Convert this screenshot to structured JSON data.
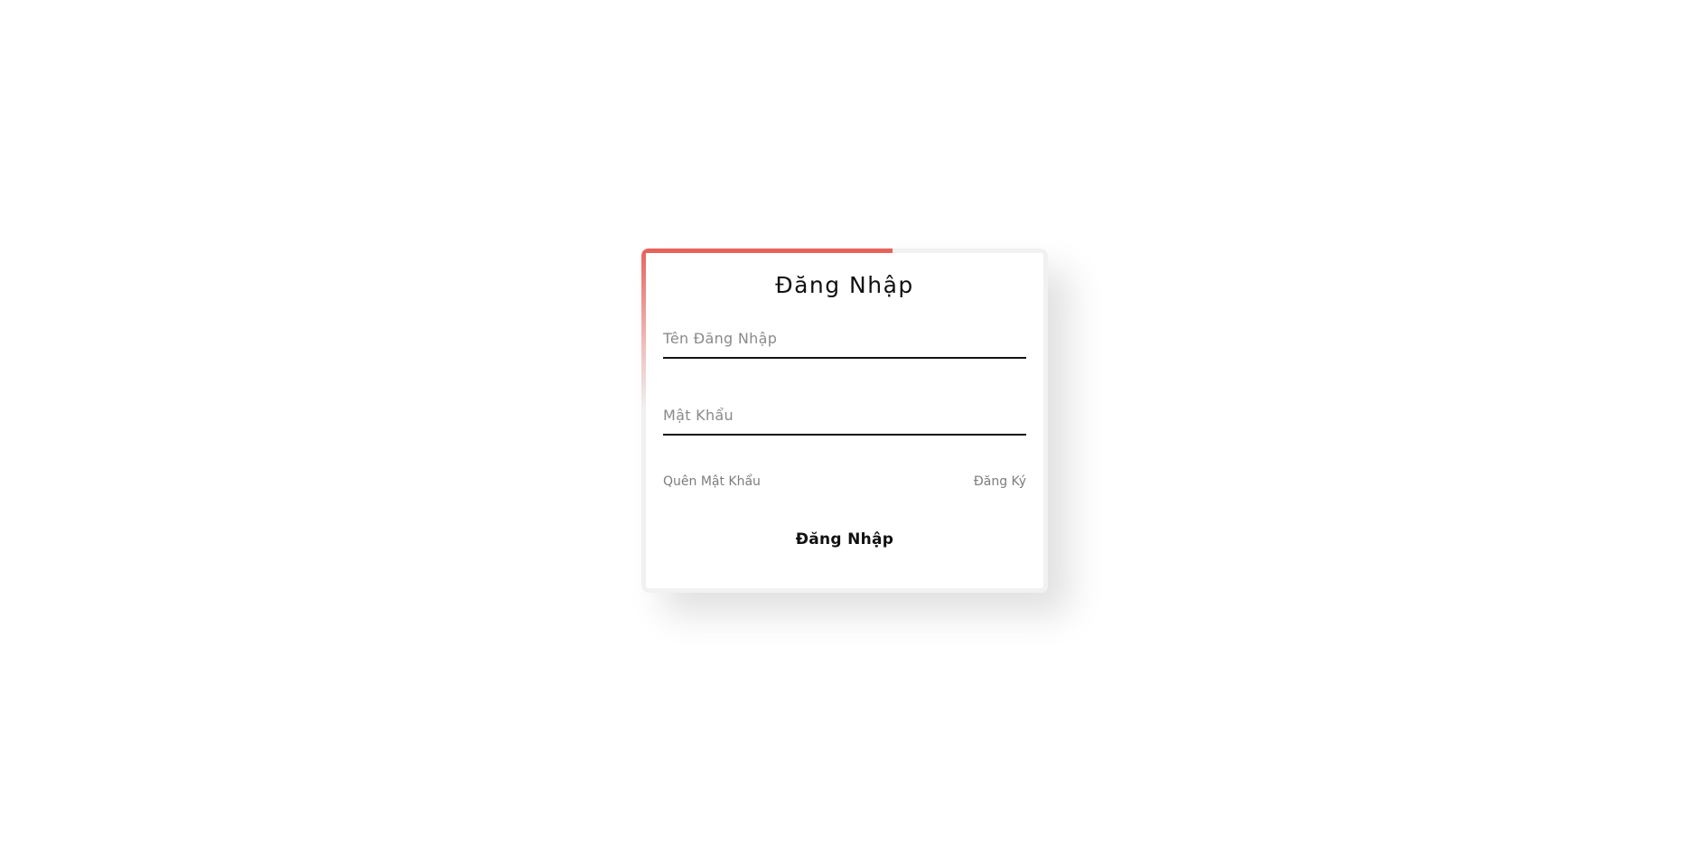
{
  "login": {
    "title": "Đăng Nhập",
    "username_placeholder": "Tên Đăng Nhập",
    "username_value": "",
    "password_placeholder": "Mật Khẩu",
    "password_value": "",
    "forgot_password_label": "Quên Mật Khẩu",
    "register_label": "Đăng Ký",
    "submit_label": "Đăng Nhập"
  },
  "colors": {
    "accent": "#e8625c",
    "text": "#111111",
    "muted": "#7d7d7d"
  }
}
